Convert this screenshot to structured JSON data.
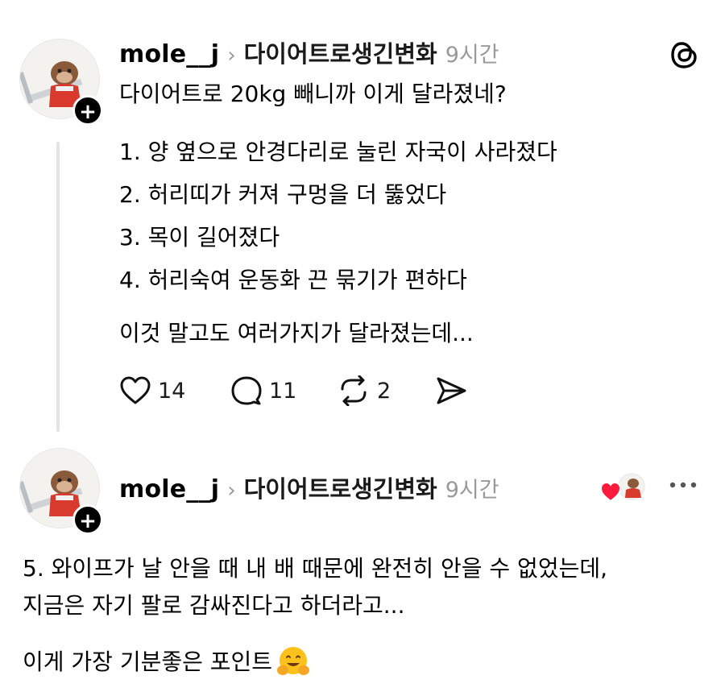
{
  "post1": {
    "username": "mole__j",
    "chevron": "›",
    "topic": "다이어트로생긴변화",
    "time": "9시간",
    "text": "다이어트로 20kg 빼니까 이게 달라졌네?",
    "list": [
      "1. 양 옆으로 안경다리로 눌린 자국이 사라졌다",
      "2. 허리띠가 커져 구멍을 더 뚫었다",
      "3. 목이 길어졌다",
      "4. 허리숙여 운동화 끈 묶기가 편하다"
    ],
    "closing": "이것 말고도 여러가지가 달라졌는데...",
    "likes": "14",
    "comments": "11",
    "reposts": "2"
  },
  "post2": {
    "username": "mole__j",
    "chevron": "›",
    "topic": "다이어트로생긴변화",
    "time": "9시간",
    "para1_line1": "5. 와이프가 날 안을 때 내 배 때문에 완전히 안을 수 없었는데,",
    "para1_line2": "지금은 자기 팔로 감싸진다고 하더라고...",
    "para2": "이게 가장 기분좋은 포인트",
    "emoji": "🤗"
  },
  "icons": {
    "app_logo": "threads-logo-icon",
    "follow": "plus-icon",
    "like": "heart-icon",
    "comment": "comment-icon",
    "repost": "repost-icon",
    "share": "send-icon",
    "more": "more-dots-icon",
    "liked_by": "heart-badge-icon"
  }
}
